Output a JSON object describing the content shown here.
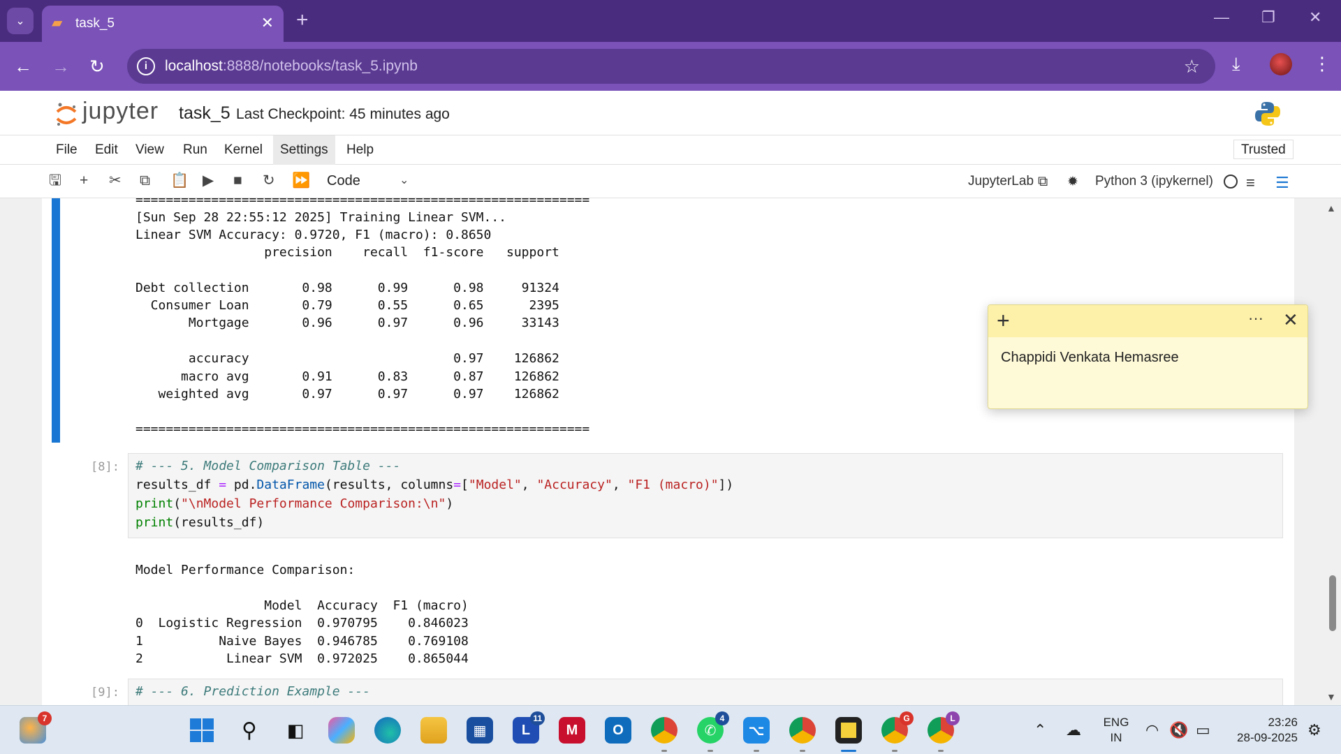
{
  "browser": {
    "tab_title": "task_5",
    "url_host": "localhost",
    "url_path": ":8888/notebooks/task_5.ipynb"
  },
  "jupyter": {
    "logo_text": "jupyter",
    "notebook_name": "task_5",
    "checkpoint": "Last Checkpoint: 45 minutes ago",
    "menu": [
      "File",
      "Edit",
      "View",
      "Run",
      "Kernel",
      "Settings",
      "Help"
    ],
    "trusted": "Trusted",
    "cell_type": "Code",
    "jupyterlab_label": "JupyterLab",
    "kernel_name": "Python 3 (ipykernel)"
  },
  "output_top": [
    "============================================================",
    "[Sun Sep 28 22:55:12 2025] Training Linear SVM...",
    "Linear SVM Accuracy: 0.9720, F1 (macro): 0.8650",
    "                 precision    recall  f1-score   support",
    "",
    "Debt collection       0.98      0.99      0.98     91324",
    "  Consumer Loan       0.79      0.55      0.65      2395",
    "       Mortgage       0.96      0.97      0.96     33143",
    "",
    "       accuracy                           0.97    126862",
    "      macro avg       0.91      0.83      0.87    126862",
    "   weighted avg       0.97      0.97      0.97    126862",
    "",
    "============================================================"
  ],
  "cell8": {
    "prompt": "[8]:",
    "comment": "# --- 5. Model Comparison Table ---",
    "l2_a": "results_df ",
    "l2_eq": "=",
    "l2_b": " pd.",
    "l2_c": "DataFrame",
    "l2_d": "(results, columns",
    "l2_eq2": "=",
    "l2_e": "[",
    "l2_s1": "\"Model\"",
    "l2_f": ", ",
    "l2_s2": "\"Accuracy\"",
    "l2_g": ", ",
    "l2_s3": "\"F1 (macro)\"",
    "l2_h": "])",
    "l3_kw": "print",
    "l3_a": "(",
    "l3_s": "\"\\nModel Performance Comparison:\\n\"",
    "l3_b": ")",
    "l4_kw": "print",
    "l4_a": "(results_df)"
  },
  "output_comparison": [
    "Model Performance Comparison:",
    "",
    "                 Model  Accuracy  F1 (macro)",
    "0  Logistic Regression  0.970795    0.846023",
    "1          Naive Bayes  0.946785    0.769108",
    "2           Linear SVM  0.972025    0.865044"
  ],
  "cell9": {
    "prompt": "[9]:",
    "comment": "# --- 6. Prediction Example ---"
  },
  "sticky_note": {
    "text": "Chappidi Venkata Hemasree",
    "more": "···"
  },
  "taskbar": {
    "badges": {
      "weather": "7",
      "lens": "11",
      "whatsapp": "4",
      "chrome_g": "G",
      "chrome_l": "L"
    },
    "lang_line1": "ENG",
    "lang_line2": "IN",
    "time": "23:26",
    "date": "28-09-2025"
  },
  "colors": {
    "chrome_purple": "#4a2c7e",
    "addr_purple": "#7a52b8",
    "active_cell": "#1976d2",
    "sticky": "#fef9d7"
  }
}
